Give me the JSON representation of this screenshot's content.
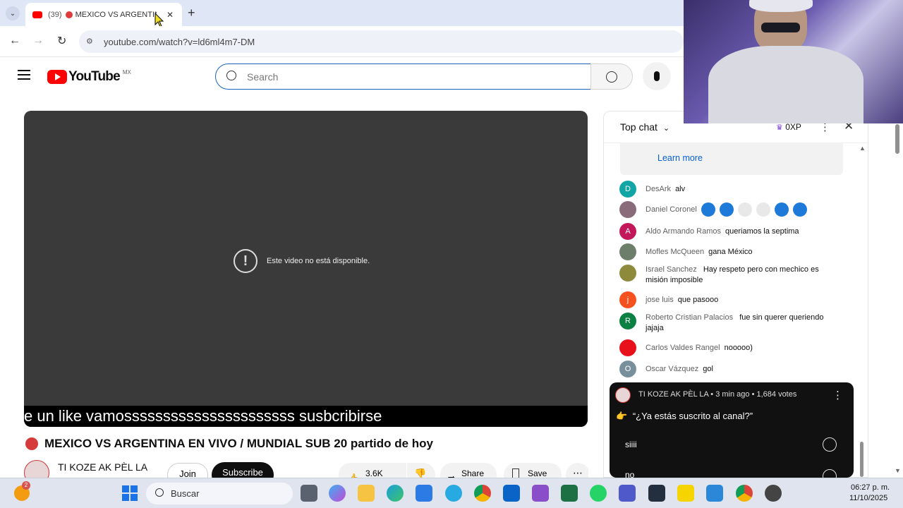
{
  "browser": {
    "tab": {
      "count_prefix": "(39)",
      "title": "MEXICO VS ARGENTIN..."
    },
    "url": "youtube.com/watch?v=ld6ml4m7-DM"
  },
  "youtube": {
    "logo_text": "YouTube",
    "country": "MX",
    "search_placeholder": "Search"
  },
  "player": {
    "error_text": "Este video no está disponible.",
    "ticker": "e un like    vamossssssssssssssssssssss                       susbcribirse"
  },
  "video": {
    "title": "MEXICO VS ARGENTINA EN VIVO / MUNDIAL SUB 20 partido de hoy",
    "channel": "TI KOZE AK PÈL LA",
    "join_label": "Join",
    "subscribe_label": "Subscribe",
    "likes": "3.6K",
    "share_label": "Share",
    "save_label": "Save"
  },
  "chat": {
    "mode": "Top chat",
    "xp": "0XP",
    "learn_more": "Learn more",
    "messages": [
      {
        "initial": "D",
        "color": "#12a5a5",
        "author": "DesArk",
        "text": "alv"
      },
      {
        "initial": "",
        "color": "#8a6b7a",
        "author": "Daniel Coronel",
        "text": ""
      },
      {
        "initial": "A",
        "color": "#c2185b",
        "author": "Aldo Armando Ramos",
        "text": "queriamos la septima"
      },
      {
        "initial": "",
        "color": "#6d7f6a",
        "author": "Mofles McQueen",
        "text": "gana México"
      },
      {
        "initial": "",
        "color": "#8d8a3c",
        "author": "Israel Sanchez",
        "text": "Hay respeto pero con mechico es misión imposible"
      },
      {
        "initial": "j",
        "color": "#f4511e",
        "author": "jose luis",
        "text": "que pasooo"
      },
      {
        "initial": "R",
        "color": "#0b8043",
        "author": "Roberto Cristian Palacios",
        "text": "fue sin querer queriendo jajaja"
      },
      {
        "initial": "",
        "color": "#e8111b",
        "author": "Carlos Valdes Rangel",
        "text": "nooooo)"
      },
      {
        "initial": "O",
        "color": "#78909c",
        "author": "Oscar Vázquez",
        "text": "gol"
      }
    ],
    "poll": {
      "meta": "TI KOZE AK PÈL LA • 3 min ago • 1,684 votes",
      "question": "“¿Ya estás suscrito al canal?”",
      "options": [
        "siiii",
        "no"
      ]
    }
  },
  "taskbar": {
    "search_label": "Buscar",
    "badge": "2",
    "time": "06:27 p. m.",
    "date": "11/10/2025"
  }
}
